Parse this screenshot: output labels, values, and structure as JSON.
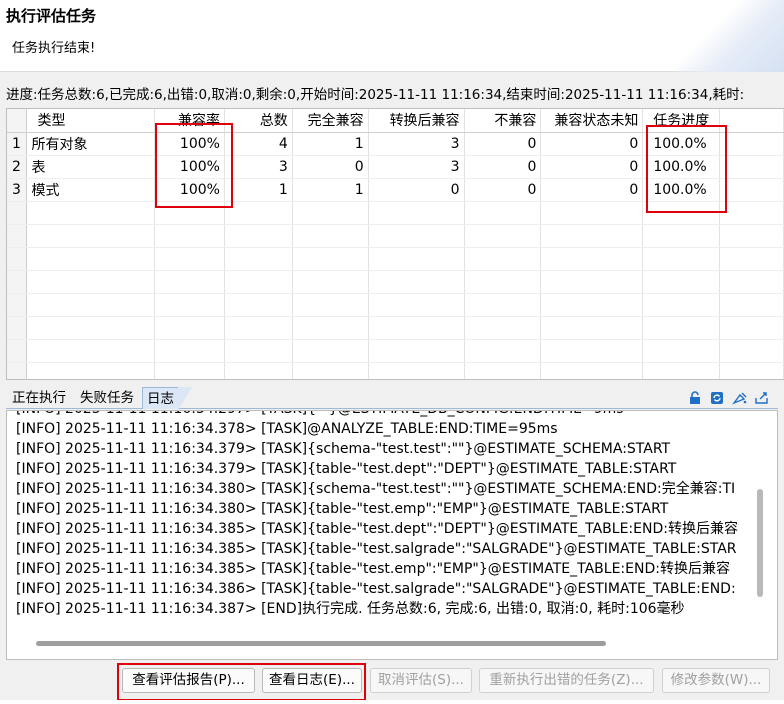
{
  "dialog": {
    "title": "执行评估任务",
    "message": "任务执行结束!"
  },
  "progress_text": "进度:任务总数:6,已完成:6,出错:0,取消:0,剩余:0,开始时间:2025-11-11 11:16:34,结束时间:2025-11-11 11:16:34,耗时:",
  "results_table": {
    "columns": [
      "类型",
      "兼容率",
      "总数",
      "完全兼容",
      "转换后兼容",
      "不兼容",
      "兼容状态未知",
      "任务进度"
    ],
    "rows": [
      {
        "index": "1",
        "cells": [
          "所有对象",
          "100%",
          "4",
          "1",
          "3",
          "0",
          "0",
          "100.0%"
        ]
      },
      {
        "index": "2",
        "cells": [
          "表",
          "100%",
          "3",
          "0",
          "3",
          "0",
          "0",
          "100.0%"
        ]
      },
      {
        "index": "3",
        "cells": [
          "模式",
          "100%",
          "1",
          "1",
          "0",
          "0",
          "0",
          "100.0%"
        ]
      }
    ]
  },
  "tabs": [
    {
      "label": "正在执行",
      "active": false
    },
    {
      "label": "失败任务",
      "active": false
    },
    {
      "label": "日志",
      "active": true
    }
  ],
  "toolbar_icons": [
    "lock-icon",
    "refresh-icon",
    "clear-log-icon",
    "export-icon"
  ],
  "log": {
    "partial_first_line": "[INFO] 2025-11-11 11:16:34.297> [TASK]{\"\"}@ESTIMATE_DB_CONFIG:END:TIME=9ms",
    "lines": [
      "[INFO] 2025-11-11 11:16:34.378> [TASK]@ANALYZE_TABLE:END:TIME=95ms",
      "[INFO] 2025-11-11 11:16:34.379> [TASK]{schema-\"test.test\":\"\"}@ESTIMATE_SCHEMA:START",
      "[INFO] 2025-11-11 11:16:34.379> [TASK]{table-\"test.dept\":\"DEPT\"}@ESTIMATE_TABLE:START",
      "[INFO] 2025-11-11 11:16:34.380> [TASK]{schema-\"test.test\":\"\"}@ESTIMATE_SCHEMA:END:完全兼容:TI",
      "[INFO] 2025-11-11 11:16:34.380> [TASK]{table-\"test.emp\":\"EMP\"}@ESTIMATE_TABLE:START",
      "[INFO] 2025-11-11 11:16:34.385> [TASK]{table-\"test.dept\":\"DEPT\"}@ESTIMATE_TABLE:END:转换后兼容",
      "[INFO] 2025-11-11 11:16:34.385> [TASK]{table-\"test.salgrade\":\"SALGRADE\"}@ESTIMATE_TABLE:STAR",
      "[INFO] 2025-11-11 11:16:34.385> [TASK]{table-\"test.emp\":\"EMP\"}@ESTIMATE_TABLE:END:转换后兼容",
      "[INFO] 2025-11-11 11:16:34.386> [TASK]{table-\"test.salgrade\":\"SALGRADE\"}@ESTIMATE_TABLE:END:",
      "[INFO] 2025-11-11 11:16:34.387> [END]执行完成. 任务总数:6, 完成:6, 出错:0, 取消:0, 耗时:106毫秒"
    ]
  },
  "buttons": [
    {
      "label": "查看评估报告(P)...",
      "enabled": true
    },
    {
      "label": "查看日志(E)...",
      "enabled": true
    },
    {
      "label": "取消评估(S)...",
      "enabled": false
    },
    {
      "label": "重新执行出错的任务(Z)...",
      "enabled": false
    },
    {
      "label": "修改参数(W)...",
      "enabled": false
    }
  ],
  "colors": {
    "annotation_red": "#e0000b",
    "icon_blue": "#1f6fc5",
    "active_tab": "#dbe7f6"
  }
}
